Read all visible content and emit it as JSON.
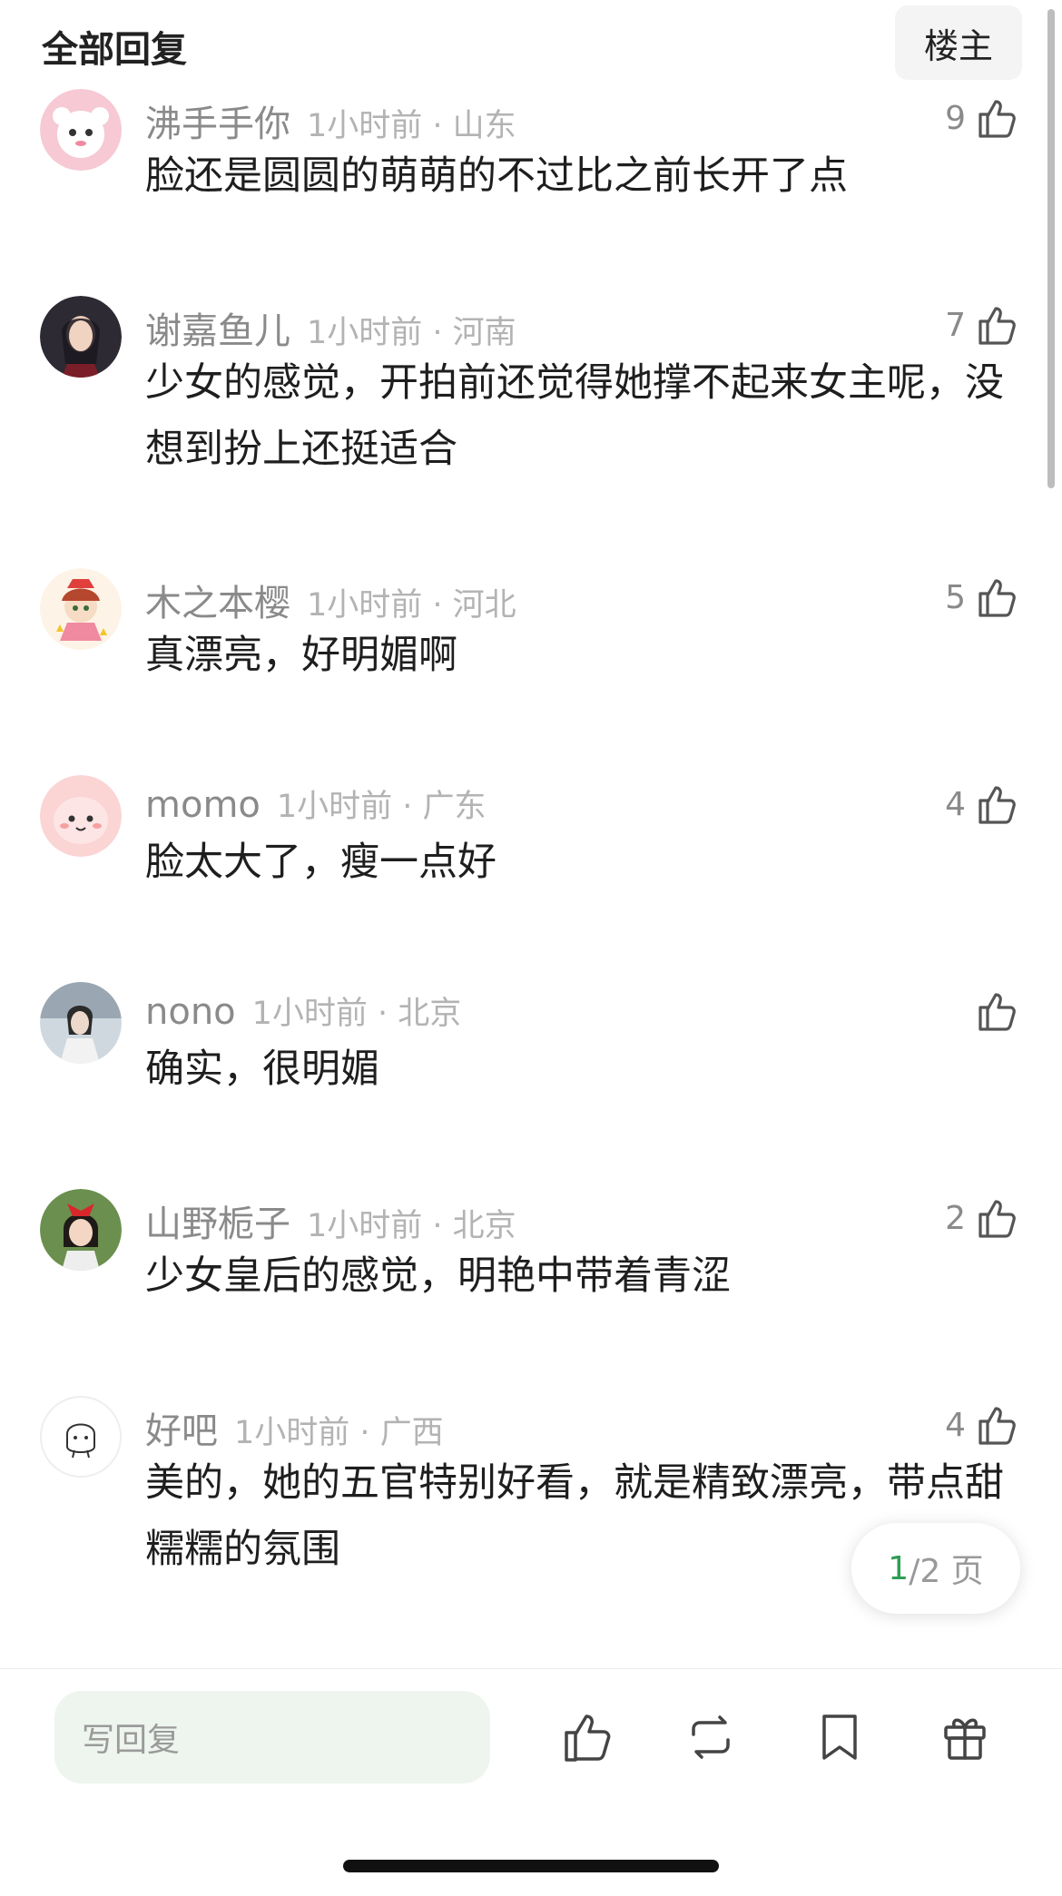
{
  "header": {
    "title": "全部回复",
    "owner_button": "楼主"
  },
  "comments": [
    {
      "user": "沸手手你",
      "time": "1小时前 · 山东",
      "likes": "9",
      "text": "脸还是圆圆的萌萌的不过比之前长开了点",
      "avatar_color": "#f6c9d4"
    },
    {
      "user": "谢嘉鱼儿",
      "time": "1小时前 · 河南",
      "likes": "7",
      "text": "少女的感觉，开拍前还觉得她撑不起来女主呢，没想到扮上还挺适合",
      "avatar_color": "#2d2a33"
    },
    {
      "user": "木之本樱",
      "time": "1小时前 · 河北",
      "likes": "5",
      "text": "真漂亮，好明媚啊",
      "avatar_color": "#f3d8a8"
    },
    {
      "user": "momo",
      "time": "1小时前 · 广东",
      "likes": "4",
      "text": "脸太大了，瘦一点好",
      "avatar_color": "#fbd4d4"
    },
    {
      "user": "nono",
      "time": "1小时前 · 北京",
      "likes": "",
      "text": "确实，很明媚",
      "avatar_color": "#b9c3cc"
    },
    {
      "user": "山野栀子",
      "time": "1小时前 · 北京",
      "likes": "2",
      "text": "少女皇后的感觉，明艳中带着青涩",
      "avatar_color": "#6b8f4e"
    },
    {
      "user": "好吧",
      "time": "1小时前 · 广西",
      "likes": "4",
      "text": "美的，她的五官特别好看，就是精致漂亮，带点甜糯糯的氛围",
      "avatar_color": "#ffffff"
    }
  ],
  "pagination": {
    "current": "1",
    "total": "/2 页"
  },
  "bottom_bar": {
    "reply_placeholder": "写回复",
    "icons": [
      "thumbs-up-icon",
      "repost-icon",
      "bookmark-icon",
      "gift-icon"
    ]
  },
  "colors": {
    "accent": "#2f9e56",
    "input_bg": "#eef5ef"
  }
}
